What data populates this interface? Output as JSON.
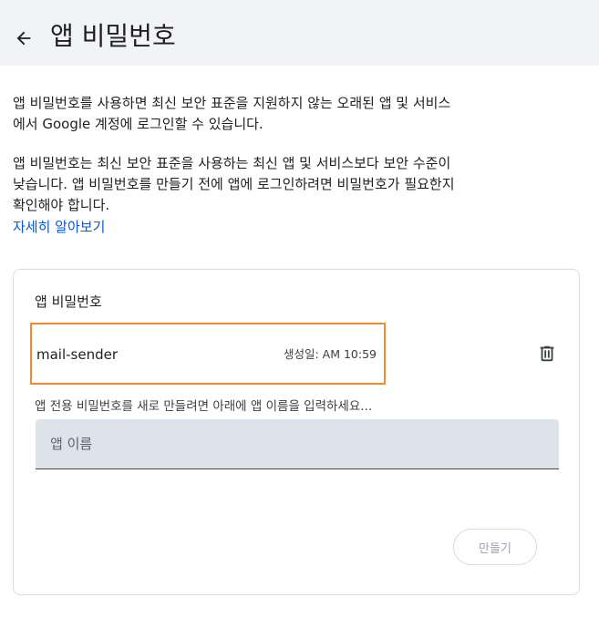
{
  "header": {
    "back_icon": "arrow-left-icon",
    "title": "앱 비밀번호"
  },
  "intro": {
    "para1": [
      "앱 비밀번호를 사용하면 최신 보안 표준을 지원하지 않는 오래된 앱 및 서비스",
      "에서 Google 계정에 로그인할 수 있습니다."
    ],
    "para2": [
      "앱 비밀번호는 최신 보안 표준을 사용하는 최신 앱 및 서비스보다 보안 수준이",
      "낮습니다. 앱 비밀번호를 만들기 전에 앱에 로그인하려면 비밀번호가 필요한지",
      "확인해야 합니다."
    ],
    "learn_more": "자세히 알아보기"
  },
  "card": {
    "title": "앱 비밀번호",
    "passwords": [
      {
        "name": "mail-sender",
        "created": "생성일: AM 10:59",
        "delete_icon": "trash-icon"
      }
    ],
    "hint": "앱 전용 비밀번호를 새로 만들려면 아래에 앱 이름을 입력하세요...",
    "input_placeholder": "앱 이름",
    "input_value": "",
    "create_label": "만들기"
  },
  "colors": {
    "header_bg": "#f1f3f7",
    "link": "#0b57d0",
    "highlight": "#f08c2a",
    "input_bg": "#dde3ea"
  }
}
